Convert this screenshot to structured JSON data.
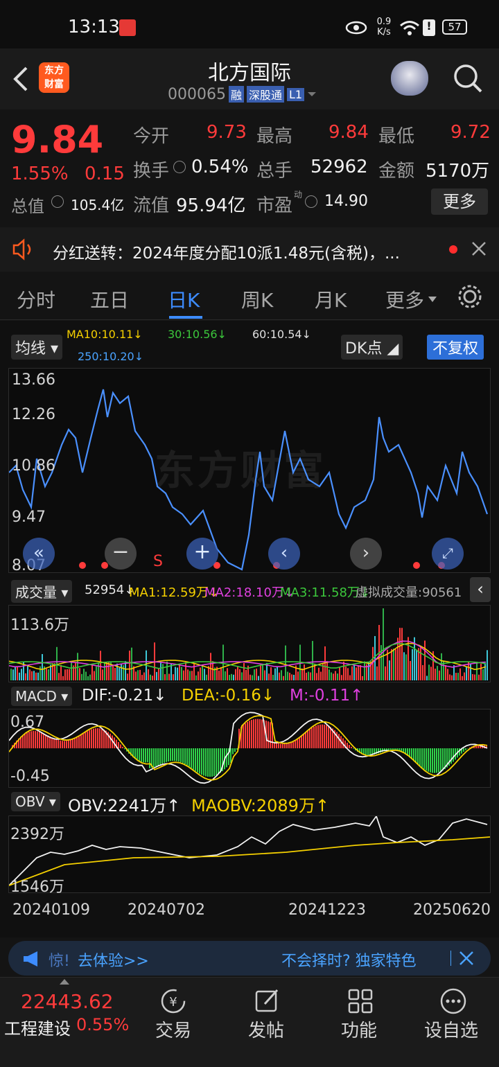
{
  "status_bar": {
    "time": "13:13",
    "net_speed_value": "0.9",
    "net_speed_unit": "K/s",
    "battery": "57"
  },
  "header": {
    "logo_text_1": "东方",
    "logo_text_2": "财富",
    "stock_name": "北方国际",
    "stock_code": "000065",
    "tag_rong": "融",
    "tag_sgt": "深股通",
    "tag_l1": "L1"
  },
  "quote": {
    "price": "9.84",
    "change_pct": "1.55%",
    "change_amt": "0.15",
    "open_label": "今开",
    "open": "9.73",
    "high_label": "最高",
    "high": "9.84",
    "low_label": "最低",
    "low": "9.72",
    "turnover_label": "换手",
    "turnover": "0.54%",
    "volume_label": "总手",
    "volume": "52962",
    "amount_label": "金额",
    "amount": "5170万",
    "mcap_label": "总值",
    "mcap": "105.4亿",
    "float_label": "流值",
    "float": "95.94亿",
    "pe_label": "市盈",
    "pe_sup": "动",
    "pe": "14.90",
    "more_btn": "更多"
  },
  "notice": {
    "text": "分红送转：2024年度分配10派1.48元(含税)，..."
  },
  "tabs": [
    {
      "label": "分时"
    },
    {
      "label": "五日"
    },
    {
      "label": "日K"
    },
    {
      "label": "周K"
    },
    {
      "label": "月K"
    },
    {
      "label": "更多"
    }
  ],
  "ma_bar": {
    "dropdown": "均线",
    "ma10": "MA10:10.11↓",
    "ma30": "30:10.56↓",
    "ma60": "60:10.54↓",
    "ma250": "250:10.20↓",
    "dk_button": "DK点",
    "adjust_button": "不复权"
  },
  "kline_axis": {
    "y1": "13.66",
    "y2": "12.26",
    "y3": "10.86",
    "y4": "9.47",
    "y5": "8.07"
  },
  "watermark": "东方财富",
  "s_marker": "S",
  "volume_bar": {
    "dropdown": "成交量",
    "value": "52954↓",
    "ma1": "MA1:12.59万↓",
    "ma2": "MA2:18.10万↓",
    "ma3": "MA3:11.58万↓",
    "virtual": "虚拟成交量:90561",
    "axis_max": "113.6万"
  },
  "macd_bar": {
    "dropdown": "MACD",
    "dif": "DIF:-0.21↓",
    "dea": "DEA:-0.16↓",
    "m": "M:-0.11↑",
    "axis_top": "0.67",
    "axis_bottom": "-0.45"
  },
  "obv_bar": {
    "dropdown": "OBV",
    "obv": "OBV:2241万↑",
    "maobv": "MAOBV:2089万↑",
    "axis_top": "2392万",
    "axis_bottom": "1546万"
  },
  "dates": {
    "d1": "20240109",
    "d2": "20240702",
    "d3": "20241223",
    "d4": "20250620"
  },
  "banner": {
    "left": "惊!",
    "try": "去体验>>",
    "right": "不会择时? 独家特色"
  },
  "bottom_nav": {
    "index_value": "22443.62",
    "index_name": "工程建设",
    "index_pct": "0.55%",
    "trade": "交易",
    "post": "发帖",
    "func": "功能",
    "watchlist": "设自选"
  },
  "colors": {
    "up": "#ff3b3b",
    "accent": "#3d8cff",
    "ma10": "#f5d000",
    "ma30": "#3cc83c",
    "ma250": "#4aa3ff",
    "macd_dea": "#f5d000",
    "macd_m": "#e040e0"
  }
}
